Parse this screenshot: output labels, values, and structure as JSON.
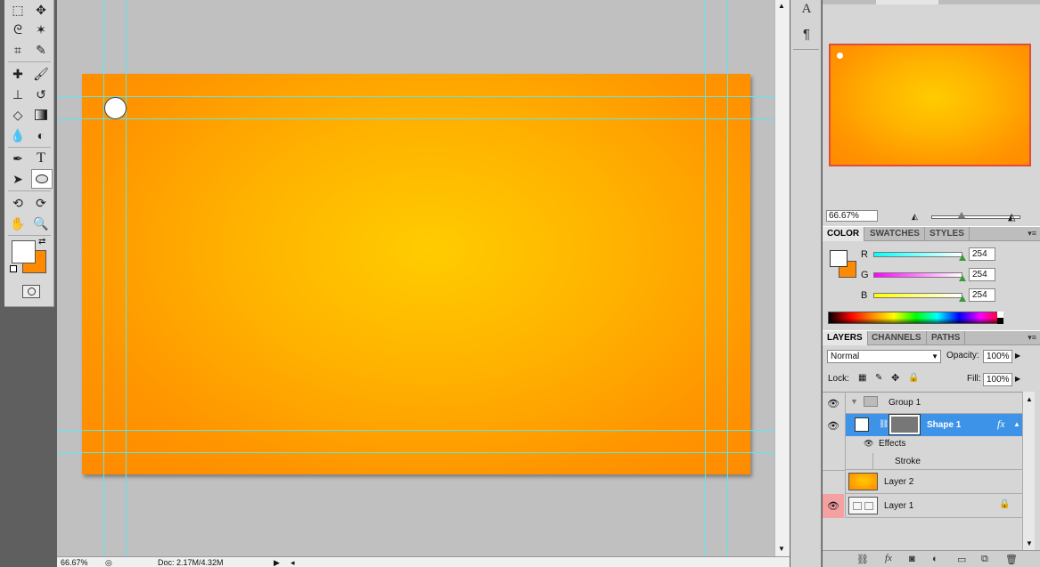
{
  "colors": {
    "accent_orange": "#ff8a00",
    "accent_yellow": "#ffcc00",
    "guide": "#5de5ee",
    "selected_layer": "#3d93e8"
  },
  "toolbox": {
    "icons": [
      "marquee-icon",
      "move-icon",
      "lasso-icon",
      "magic-wand-icon",
      "crop-icon",
      "eyedropper-icon",
      "healing-brush-icon",
      "brush-icon",
      "clone-stamp-icon",
      "history-brush-icon",
      "eraser-icon",
      "gradient-icon",
      "blur-icon",
      "dodge-icon",
      "pen-icon",
      "type-icon",
      "path-selection-icon",
      "ellipse-icon",
      "3d-rotate-icon",
      "3d-orbit-icon",
      "hand-icon",
      "zoom-icon"
    ],
    "type_glyph": "T",
    "foreground_color": "#ffffff",
    "background_color": "#ff8a00"
  },
  "status": {
    "zoom": "66.67%",
    "doc": "Doc: 2.17M/4.32M"
  },
  "navigator": {
    "zoom": "66.67%"
  },
  "color_panel": {
    "tabs": [
      "COLOR",
      "SWATCHES",
      "STYLES"
    ],
    "channels": [
      {
        "label": "R",
        "value": "254",
        "fill": 1.0
      },
      {
        "label": "G",
        "value": "254",
        "fill": 1.0
      },
      {
        "label": "B",
        "value": "254",
        "fill": 1.0
      }
    ]
  },
  "layers_panel": {
    "tabs": [
      "LAYERS",
      "CHANNELS",
      "PATHS"
    ],
    "blend_mode": "Normal",
    "opacity_label": "Opacity:",
    "opacity": "100%",
    "lock_label": "Lock:",
    "fill_label": "Fill:",
    "fill": "100%",
    "layers": {
      "group": "Group 1",
      "shape": "Shape 1",
      "fx": "fx",
      "effects": "Effects",
      "stroke": "Stroke",
      "layer2": "Layer 2",
      "layer1": "Layer 1"
    }
  }
}
